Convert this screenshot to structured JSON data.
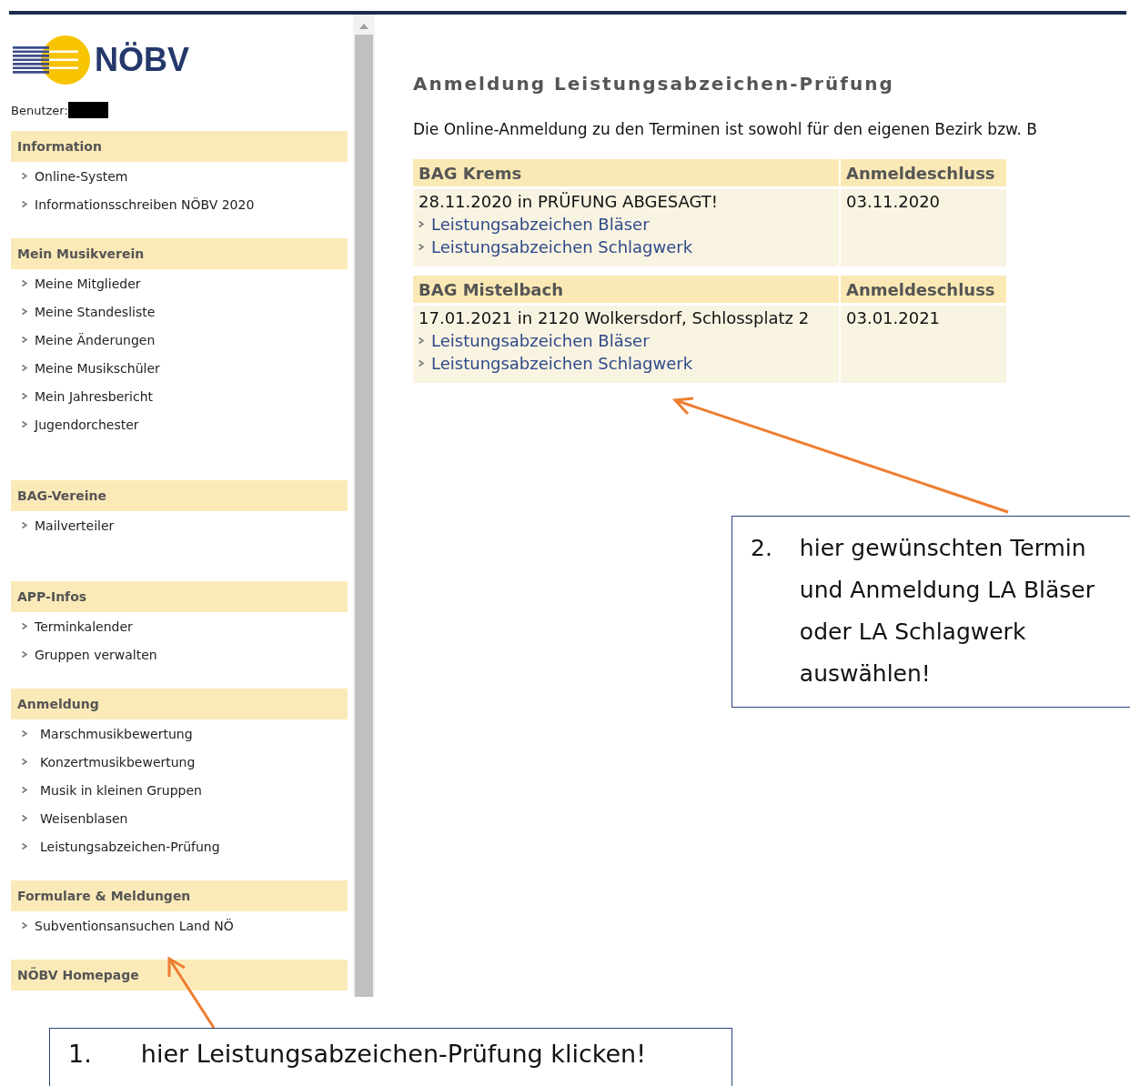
{
  "logo": {
    "text": "NÖBV"
  },
  "user": {
    "label": "Benutzer:"
  },
  "sidebar": {
    "groups": [
      {
        "title": "Information",
        "items": [
          "Online-System",
          "Informationsschreiben NÖBV 2020"
        ]
      },
      {
        "title": "Mein Musikverein",
        "items": [
          "Meine Mitglieder",
          "Meine Standesliste",
          "Meine Änderungen",
          "Meine Musikschüler",
          "Mein Jahresbericht",
          "Jugendorchester"
        ]
      },
      {
        "title": "BAG-Vereine",
        "items": [
          "Mailverteiler"
        ]
      },
      {
        "title": "APP-Infos",
        "items": [
          "Terminkalender",
          "Gruppen verwalten"
        ]
      },
      {
        "title": "Anmeldung",
        "items": [
          "Marschmusikbewertung",
          "Konzertmusikbewertung",
          "Musik in kleinen Gruppen",
          "Weisenblasen",
          "Leistungsabzeichen-Prüfung"
        ]
      },
      {
        "title": "Formulare & Meldungen",
        "items": [
          "Subventionsansuchen Land NÖ"
        ]
      },
      {
        "title": "NÖBV Homepage"
      }
    ]
  },
  "main": {
    "title": "Anmeldung Leistungsabzeichen-Prüfung",
    "intro": "Die Online-Anmeldung zu den Terminen ist sowohl für den eigenen Bezirk bzw. B",
    "tables": [
      {
        "region": "BAG Krems",
        "deadline_heading": "Anmeldeschluss",
        "event": "28.11.2020 in PRÜFUNG ABGESAGT!",
        "deadline": "03.11.2020",
        "links": [
          "Leistungsabzeichen Bläser",
          "Leistungsabzeichen Schlagwerk"
        ]
      },
      {
        "region": "BAG Mistelbach",
        "deadline_heading": "Anmeldeschluss",
        "event": "17.01.2021 in 2120 Wolkersdorf, Schlossplatz 2",
        "deadline": "03.01.2021",
        "links": [
          "Leistungsabzeichen Bläser",
          "Leistungsabzeichen Schlagwerk"
        ]
      }
    ]
  },
  "callouts": [
    {
      "number": "1.",
      "text": "hier Leistungsabzeichen-Prüfung klicken!"
    },
    {
      "number": "2.",
      "text": "hier gewünschten Termin und Anmeldung LA Bläser oder LA Schlagwerk auswählen!"
    }
  ]
}
